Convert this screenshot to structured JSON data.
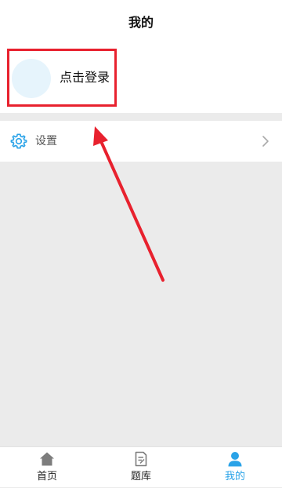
{
  "header": {
    "title": "我的"
  },
  "profile": {
    "login_label": "点击登录"
  },
  "menu": [
    {
      "label": "设置",
      "icon": "gear-icon"
    }
  ],
  "tabs": [
    {
      "label": "首页",
      "icon": "home-icon",
      "active": false
    },
    {
      "label": "题库",
      "icon": "question-bank-icon",
      "active": false
    },
    {
      "label": "我的",
      "icon": "user-icon",
      "active": true
    }
  ],
  "colors": {
    "accent": "#2aa3e8",
    "annotation": "#e8212e",
    "avatar_bg": "#e6f4fc",
    "page_bg": "#ebebeb"
  }
}
